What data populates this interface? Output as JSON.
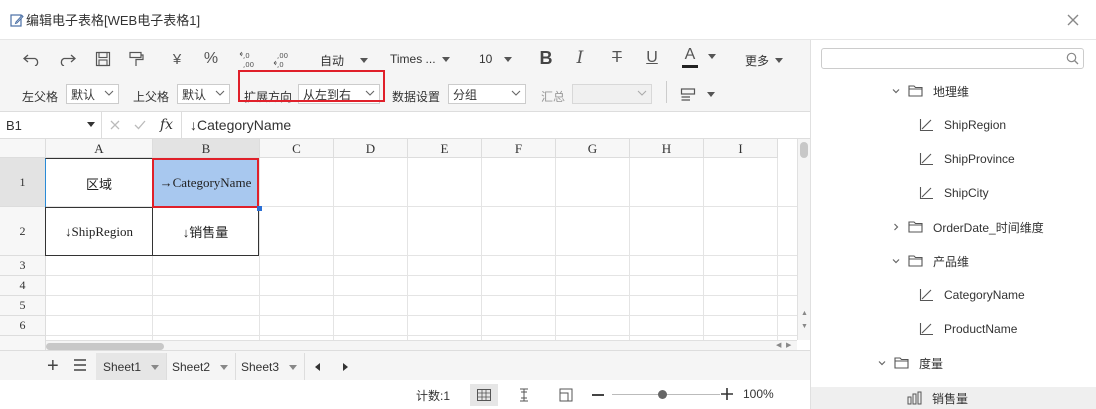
{
  "window": {
    "title": "编辑电子表格[WEB电子表格1]"
  },
  "toolbar": {
    "font_size_mode": "自动",
    "font_family": "Times ...",
    "font_size": "10",
    "more": "更多",
    "currency_symbol": "¥",
    "percent_symbol": "%",
    "bold": "B",
    "italic": "I",
    "strike": "T",
    "underline": "U",
    "font_color": "A",
    "left_parent_label": "左父格",
    "left_parent_value": "默认",
    "top_parent_label": "上父格",
    "top_parent_value": "默认",
    "expand_dir_label": "扩展方向",
    "expand_dir_value": "从左到右",
    "data_setting_label": "数据设置",
    "data_setting_value": "分组",
    "summary_label": "汇总",
    "summary_value": ""
  },
  "formula_bar": {
    "cell_ref": "B1",
    "fx": "fx",
    "content": "↓CategoryName"
  },
  "grid": {
    "columns": [
      "A",
      "B",
      "C",
      "D",
      "E",
      "F",
      "G",
      "H",
      "I"
    ],
    "rows": [
      "1",
      "2",
      "3",
      "4",
      "5",
      "6"
    ],
    "cells": {
      "A1": "区域",
      "B1": "→CategoryName",
      "A2": "↓ShipRegion",
      "B2": "↓销售量"
    }
  },
  "sheets": {
    "tabs": [
      "Sheet1",
      "Sheet2",
      "Sheet3"
    ],
    "active": "Sheet1"
  },
  "status": {
    "count": "计数:1",
    "zoom": "100%"
  },
  "right_panel": {
    "search_placeholder": "",
    "tree": [
      {
        "label": "地理维",
        "type": "folder",
        "expanded": true
      },
      {
        "label": "ShipRegion",
        "type": "level"
      },
      {
        "label": "ShipProvince",
        "type": "level"
      },
      {
        "label": "ShipCity",
        "type": "level"
      },
      {
        "label": "OrderDate_时间维度",
        "type": "folder",
        "expanded": false
      },
      {
        "label": "产品维",
        "type": "folder",
        "expanded": true
      },
      {
        "label": "CategoryName",
        "type": "level"
      },
      {
        "label": "ProductName",
        "type": "level"
      },
      {
        "label": "度量",
        "type": "folder",
        "expanded": true
      },
      {
        "label": "销售量",
        "type": "measure"
      }
    ]
  },
  "colors": {
    "selection_fill": "#a8c8ef",
    "highlight_border": "#e0202a",
    "fill_handle": "#2a6fd6"
  }
}
